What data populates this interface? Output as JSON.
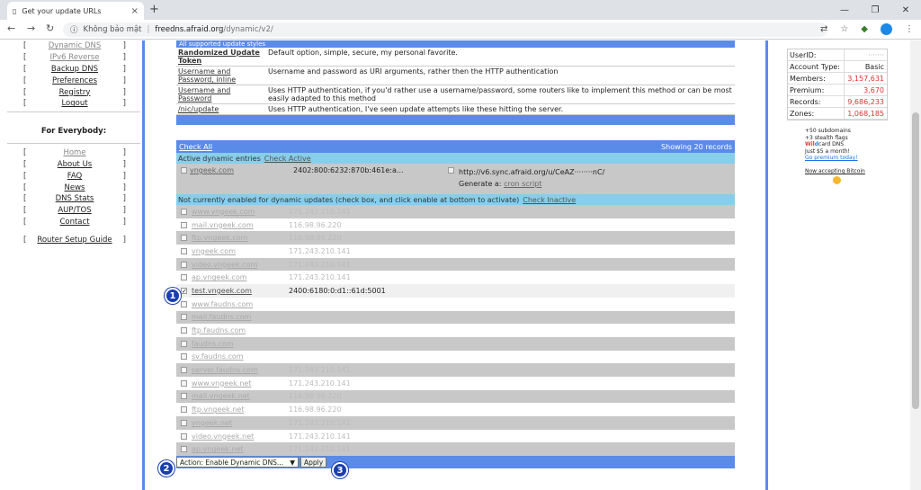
{
  "browser": {
    "tab_title": "Get your update URLs",
    "security": "Không bảo mật",
    "url_host": "freedns.afraid.org",
    "url_path": "/dynamic/v2/"
  },
  "menu": {
    "top": [
      {
        "label": "Dynamic DNS",
        "gray": true
      },
      {
        "label": "IPv6 Reverse",
        "gray": true
      },
      {
        "label": "Backup DNS"
      },
      {
        "label": "Preferences"
      },
      {
        "label": "Registry"
      },
      {
        "label": "Logout"
      }
    ],
    "heading": "For Everybody:",
    "everyone": [
      {
        "label": "Home",
        "gray": true
      },
      {
        "label": "About Us"
      },
      {
        "label": "FAQ"
      },
      {
        "label": "News"
      },
      {
        "label": "DNS Stats"
      },
      {
        "label": "AUP/TOS"
      },
      {
        "label": "Contact"
      }
    ],
    "router": "Router Setup Guide",
    "bracket_open": "[",
    "bracket_close": "]"
  },
  "styles": {
    "header": "All supported update styles",
    "rows": [
      {
        "name": "Randomized Update Token",
        "desc": "Default option, simple, secure, my personal favorite.",
        "bold": true
      },
      {
        "name": "Username and Password, inline",
        "desc": "Username and password as URI arguments, rather then the HTTP authentication"
      },
      {
        "name": "Username and Password",
        "desc": "Uses HTTP authentication, if you'd rather use a username/password, some routers like to implement this method or can be most easily adapted to this method"
      },
      {
        "name": "/nic/update",
        "desc": "Uses HTTP authentication, I've seen update attempts like these hitting the server."
      }
    ]
  },
  "records": {
    "check_all": "Check All",
    "showing": "Showing 20 records",
    "active_label": "Active dynamic entries",
    "check_active": "Check Active",
    "active": {
      "domain": "vngeek.com",
      "ip": "2402:800:6232:870b:461e:a...",
      "url": "http://v6.sync.afraid.org/u/CeAZ········nC/",
      "generate_label": "Generate a:",
      "cron": "cron script"
    },
    "inactive_label": "Not currently enabled for dynamic updates (check box, and click enable at bottom to activate)",
    "check_inactive": "Check Inactive",
    "inactive": [
      {
        "domain": "www.vngeek.com",
        "ip": "171.243.210.141"
      },
      {
        "domain": "mail.vngeek.com",
        "ip": "116.98.96.220"
      },
      {
        "domain": "ftp.vngeek.com",
        "ip": "116.98.96.220"
      },
      {
        "domain": "vngeek.com",
        "ip": "171.243.210.141"
      },
      {
        "domain": "video.vngeek.com",
        "ip": "171.243.210.141"
      },
      {
        "domain": "ap.vngeek.com",
        "ip": "171.243.210.141"
      },
      {
        "domain": "test.vngeek.com",
        "ip": "2400:6180:0:d1::61d:5001",
        "checked": true
      },
      {
        "domain": "www.faudns.com",
        "ip": ""
      },
      {
        "domain": "mail.faudns.com",
        "ip": ""
      },
      {
        "domain": "ftp.faudns.com",
        "ip": ""
      },
      {
        "domain": "faudns.com",
        "ip": ""
      },
      {
        "domain": "sv.faudns.com",
        "ip": ""
      },
      {
        "domain": "server.faudns.com",
        "ip": "171.243.210.141"
      },
      {
        "domain": "www.vngeek.net",
        "ip": "171.243.210.141"
      },
      {
        "domain": "mail.vngeek.net",
        "ip": "116.98.96.220"
      },
      {
        "domain": "ftp.vngeek.net",
        "ip": "116.98.96.220"
      },
      {
        "domain": "vngeek.net",
        "ip": "171.243.210.141"
      },
      {
        "domain": "video.vngeek.net",
        "ip": "171.243.210.141"
      },
      {
        "domain": "ap.vngeek.net",
        "ip": "171.243.210.141"
      }
    ],
    "action_select": "Action: Enable Dynamic DNS...",
    "apply": "Apply"
  },
  "badges": [
    "1",
    "2",
    "3"
  ],
  "account": [
    {
      "k": "UserID:",
      "v": "·······",
      "cls": "blur"
    },
    {
      "k": "Account Type:",
      "v": "Basic",
      "cls": "b"
    },
    {
      "k": "Members:",
      "v": "3,157,631"
    },
    {
      "k": "Premium:",
      "v": "3,670"
    },
    {
      "k": "Records:",
      "v": "9,686,233"
    },
    {
      "k": "Zones:",
      "v": "1,068,185"
    }
  ],
  "promo": {
    "l1": "+50 subdomains",
    "l2": "+3 stealth flags",
    "w": "Wil",
    "d": "d",
    "card": "card DNS",
    "l4": "Just $5 a month!",
    "l5": "Go premium today!",
    "btc": "Now accepting Bitcoin"
  },
  "colors": {
    "accent": "#5b8be8",
    "section": "#87ceeb",
    "badge": "#1a3fb0",
    "red": "#d33"
  }
}
